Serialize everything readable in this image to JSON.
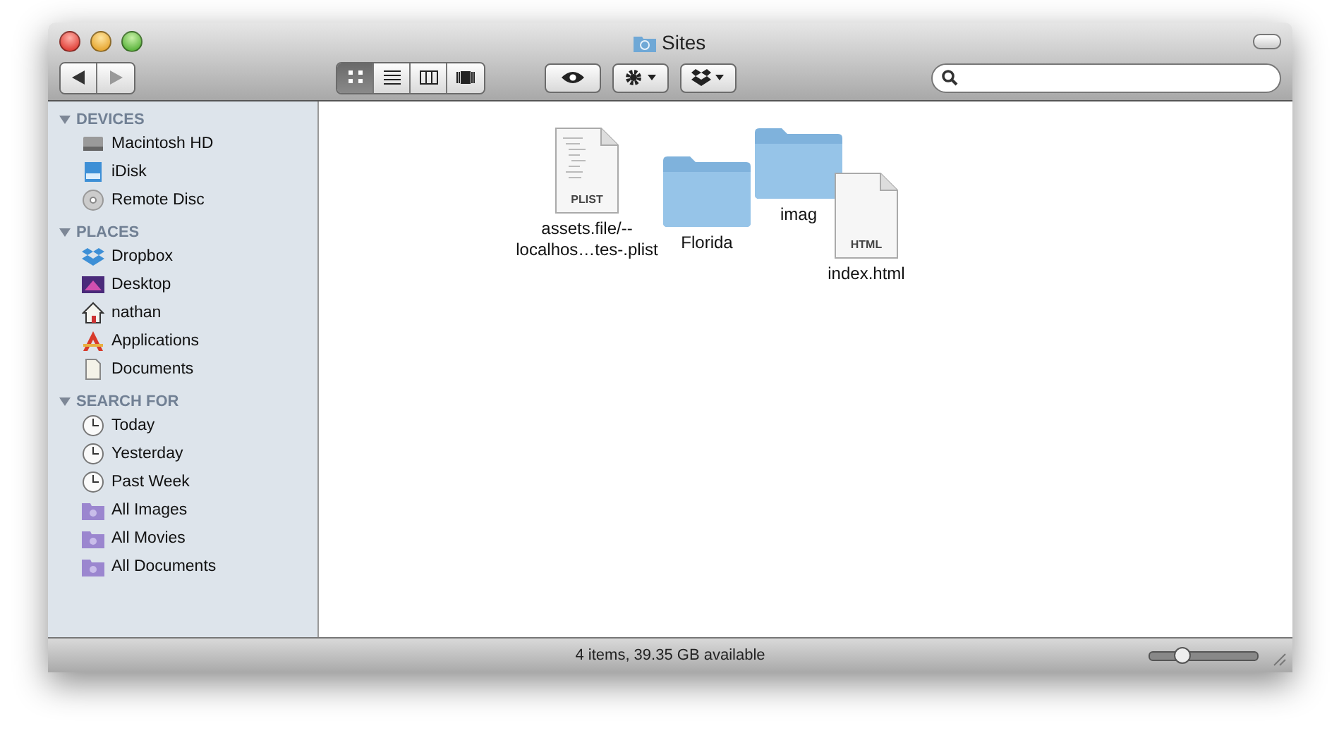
{
  "window": {
    "title": "Sites"
  },
  "toolbar": {
    "views": [
      {
        "kind": "icon",
        "selected": true
      },
      {
        "kind": "list",
        "selected": false
      },
      {
        "kind": "column",
        "selected": false
      },
      {
        "kind": "coverflow",
        "selected": false
      }
    ]
  },
  "sidebar": {
    "sections": [
      {
        "title": "DEVICES",
        "expanded": true,
        "items": [
          {
            "label": "Macintosh HD",
            "kind": "disk"
          },
          {
            "label": "iDisk",
            "kind": "idisk"
          },
          {
            "label": "Remote Disc",
            "kind": "disc"
          }
        ]
      },
      {
        "title": "PLACES",
        "expanded": true,
        "items": [
          {
            "label": "Dropbox",
            "kind": "dropbox"
          },
          {
            "label": "Desktop",
            "kind": "desktop"
          },
          {
            "label": "nathan",
            "kind": "home"
          },
          {
            "label": "Applications",
            "kind": "apps"
          },
          {
            "label": "Documents",
            "kind": "docs"
          }
        ]
      },
      {
        "title": "SEARCH FOR",
        "expanded": true,
        "items": [
          {
            "label": "Today",
            "kind": "clock"
          },
          {
            "label": "Yesterday",
            "kind": "clock"
          },
          {
            "label": "Past Week",
            "kind": "clock"
          },
          {
            "label": "All Images",
            "kind": "smart"
          },
          {
            "label": "All Movies",
            "kind": "smart"
          },
          {
            "label": "All Documents",
            "kind": "smart"
          }
        ]
      }
    ]
  },
  "files": [
    {
      "kind": "plist",
      "badge": "PLIST",
      "name": [
        "assets.file/--",
        "localhos…tes-.plist"
      ]
    },
    {
      "kind": "folder",
      "name": [
        "Florida"
      ]
    },
    {
      "kind": "folder",
      "name": [
        "imag"
      ]
    },
    {
      "kind": "html",
      "badge": "HTML",
      "name": [
        "index.html"
      ]
    }
  ],
  "status_bar": {
    "text": "4 items, 39.35 GB available",
    "zoom": {
      "level": 0.24
    }
  }
}
